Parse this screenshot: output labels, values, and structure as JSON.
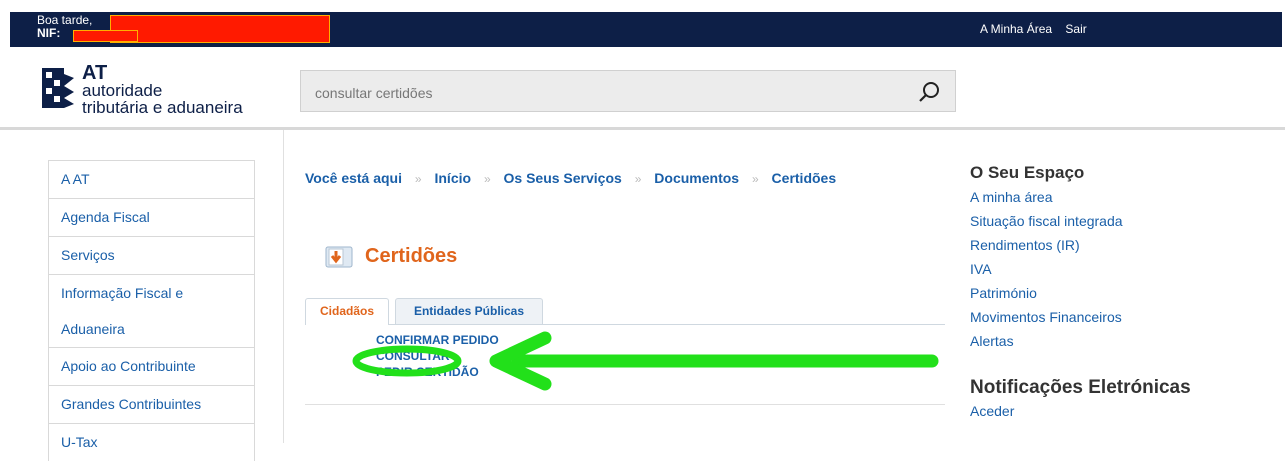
{
  "topbar": {
    "greeting": "Boa tarde,",
    "nif_label": "NIF:",
    "links": [
      "A Minha Área",
      "Sair"
    ]
  },
  "header": {
    "logo_at": "AT",
    "logo_line1": "autoridade",
    "logo_line2": "tributária e aduaneira",
    "search_placeholder": "consultar certidões"
  },
  "sidebar": {
    "items": [
      {
        "label": "A AT"
      },
      {
        "label": "Agenda Fiscal"
      },
      {
        "label": "Serviços"
      },
      {
        "label": "Informação Fiscal e Aduaneira"
      },
      {
        "label": "Apoio ao Contribuinte"
      },
      {
        "label": "Grandes Contribuintes"
      },
      {
        "label": "U-Tax"
      }
    ]
  },
  "breadcrumb": {
    "items": [
      "Você está aqui",
      "Início",
      "Os Seus Serviços",
      "Documentos",
      "Certidões"
    ]
  },
  "page": {
    "title": "Certidões",
    "tabs": [
      "Cidadãos",
      "Entidades Públicas"
    ],
    "actions": [
      "CONFIRMAR PEDIDO",
      "CONSULTAR",
      "PEDIR CERTIDÃO"
    ]
  },
  "right": {
    "section1_title": "O Seu Espaço",
    "section1_links": [
      "A minha área",
      "Situação fiscal integrada",
      "Rendimentos (IR)",
      "IVA",
      "Património",
      "Movimentos Financeiros",
      "Alertas"
    ],
    "section2_title": "Notificações Eletrónicas",
    "section2_links": [
      "Aceder"
    ]
  },
  "colors": {
    "topbar": "#0d1f47",
    "link": "#1a5fa8",
    "title_orange": "#e0651c",
    "redaction": "#ff1a00",
    "annotation_green": "#22e01a"
  }
}
